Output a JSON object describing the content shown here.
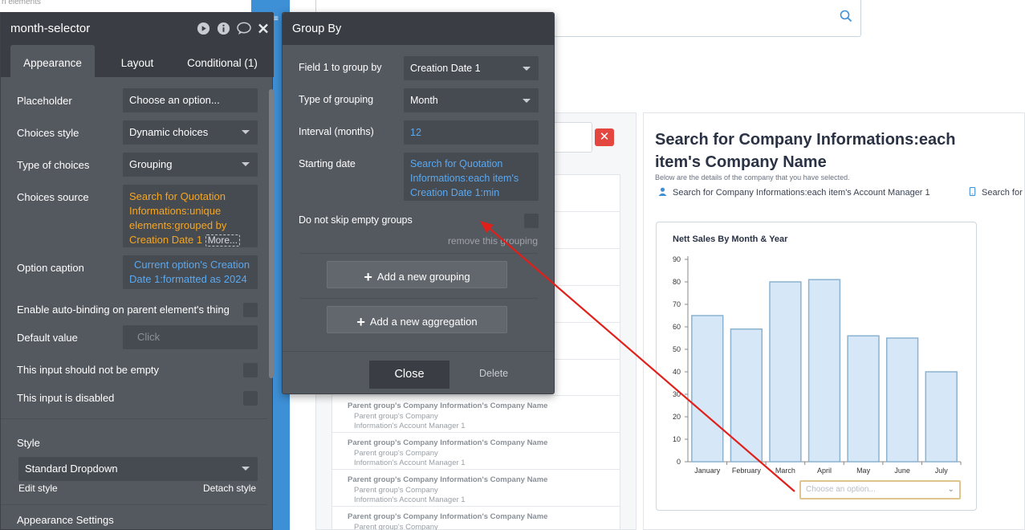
{
  "top_fragment": "ri elements",
  "search": {
    "icon": "search-icon"
  },
  "list_rows": [
    {
      "title": "Parent group's Company Information's Company Name",
      "l2": "Parent group's Company",
      "l3": "Information's Account Manager 1"
    },
    {
      "title": "Parent group's Company Information's Company Name",
      "l2": "Parent group's Company",
      "l3": "Information's Account Manager 1"
    },
    {
      "title": "Parent group's Company Information's Company Name",
      "l2": "Parent group's Company",
      "l3": "Information's Account Manager 1"
    },
    {
      "title": "Parent group's Company Information's Company Name",
      "l2": "Parent group's Company",
      "l3": ""
    }
  ],
  "company": {
    "title": "Search for Company Informations:each item's Company Name",
    "subtitle": "Below are the details of the company that you have selected.",
    "account_manager": "Search for Company Informations:each item's Account Manager 1",
    "phone_fragment": "Search for"
  },
  "chart_data": {
    "type": "bar",
    "title": "Nett Sales By Month & Year",
    "categories": [
      "January",
      "February",
      "March",
      "April",
      "May",
      "June",
      "July"
    ],
    "values": [
      65,
      59,
      80,
      81,
      56,
      55,
      40
    ],
    "ylim": [
      0,
      90
    ],
    "yticks": [
      0,
      10,
      20,
      30,
      40,
      50,
      60,
      70,
      80,
      90
    ],
    "grid": false
  },
  "chart_select": {
    "placeholder": "Choose an option..."
  },
  "props": {
    "title": "month-selector",
    "tabs": [
      "Appearance",
      "Layout",
      "Conditional (1)"
    ],
    "placeholder_label": "Placeholder",
    "placeholder_value": "Choose an option...",
    "choices_style_label": "Choices style",
    "choices_style_value": "Dynamic choices",
    "type_label": "Type of choices",
    "type_value": "Grouping",
    "source_label": "Choices source",
    "source_value": "Search for Quotation Informations:unique elements:grouped by Creation Date 1",
    "source_more": "More...",
    "caption_label": "Option caption",
    "caption_value": "Current option's Creation Date 1:formatted as 2024",
    "autobind_label": "Enable auto-binding on parent element's thing",
    "default_label": "Default value",
    "default_placeholder": "Click",
    "notempty_label": "This input should not be empty",
    "disabled_label": "This input is disabled",
    "style_label": "Style",
    "style_value": "Standard Dropdown",
    "edit_style": "Edit style",
    "detach_style": "Detach style",
    "appearance_settings": "Appearance Settings"
  },
  "groupby": {
    "title": "Group By",
    "field_label": "Field 1 to group by",
    "field_value": "Creation Date 1",
    "type_label": "Type of grouping",
    "type_value": "Month",
    "interval_label": "Interval (months)",
    "interval_value": "12",
    "start_label": "Starting date",
    "start_value": "Search for Quotation Informations:each item's Creation Date 1:min",
    "skip_label": "Do not skip empty groups",
    "remove": "remove this grouping",
    "add_grouping": "Add a new grouping",
    "add_aggregation": "Add a new aggregation",
    "close": "Close",
    "delete": "Delete"
  },
  "colors": {
    "accent_blue": "#3d8fd6",
    "arrow": "#e0201b",
    "orange": "#f5a623",
    "panel": "#54585f"
  }
}
